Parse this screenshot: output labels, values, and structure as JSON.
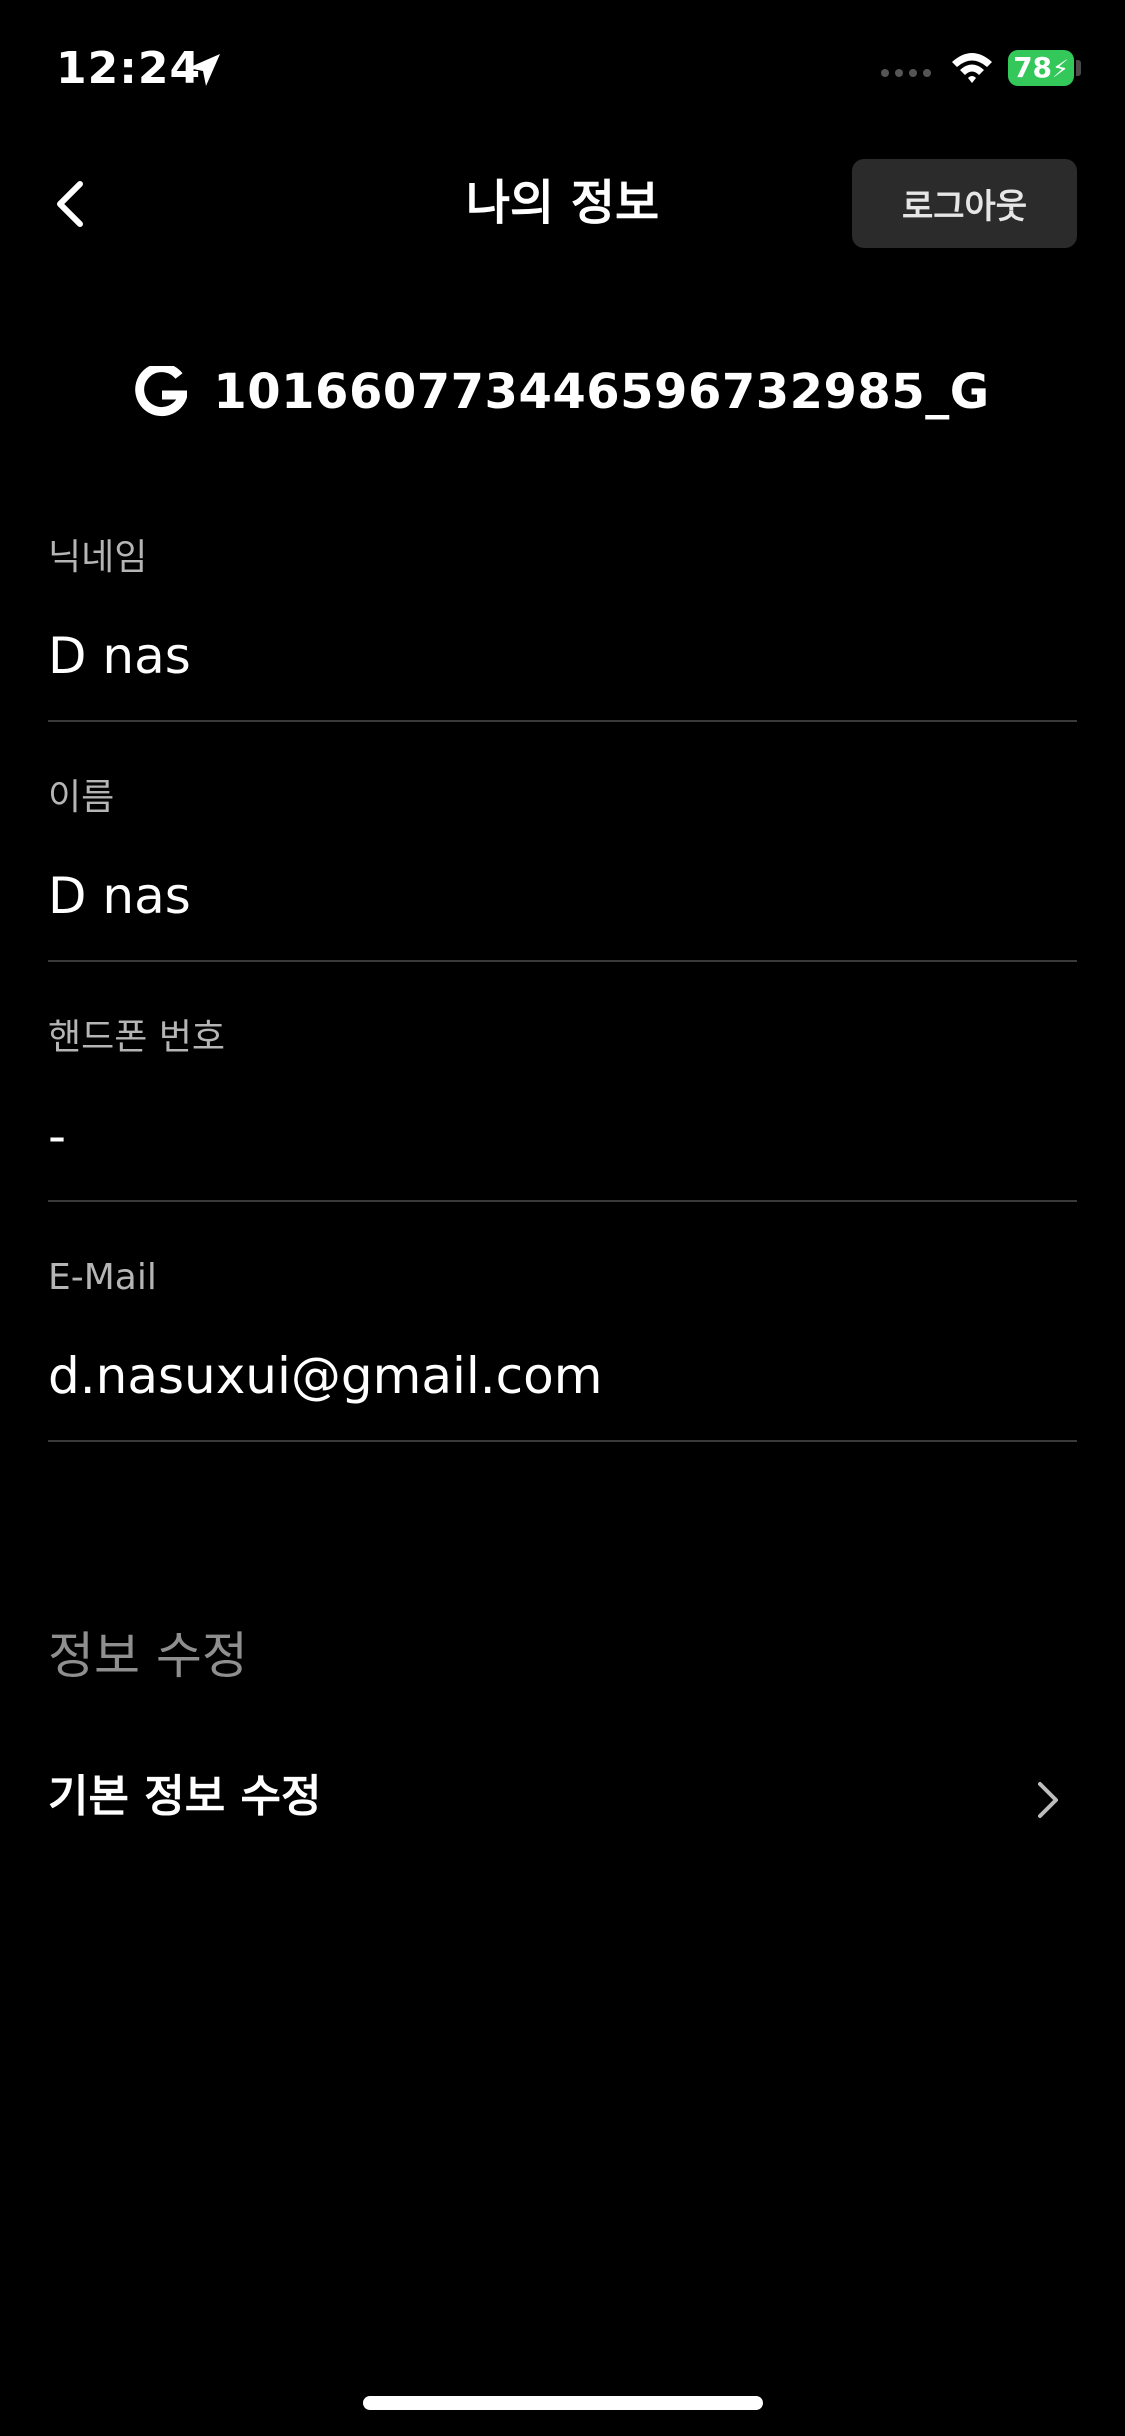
{
  "status_bar": {
    "time": "12:24",
    "battery": "78",
    "icons": [
      "location-arrow-icon",
      "cellular-signal-icon",
      "wifi-icon",
      "battery-charging-icon"
    ]
  },
  "nav": {
    "back_icon": "chevron-left-icon",
    "title": "나의 정보",
    "logout_label": "로그아웃"
  },
  "account": {
    "provider_icon": "google-icon",
    "id": "101660773446596732985_G"
  },
  "fields": {
    "nickname": {
      "label": "닉네임",
      "value": "D nas"
    },
    "name": {
      "label": "이름",
      "value": "D nas"
    },
    "phone": {
      "label": "핸드폰 번호",
      "value": "-"
    },
    "email": {
      "label": "E-Mail",
      "value": "d.nasuxui@gmail.com"
    }
  },
  "edit_section": {
    "title": "정보 수정",
    "items": [
      {
        "label": "기본 정보 수정",
        "icon": "chevron-right-icon"
      }
    ]
  },
  "colors": {
    "background": "#000000",
    "text_primary": "#ffffff",
    "text_secondary": "#b5b5b5",
    "section_title": "#8f8f8f",
    "divider": "#3a3a3a",
    "button_bg": "#2b2b2b",
    "battery_green": "#34c759"
  }
}
